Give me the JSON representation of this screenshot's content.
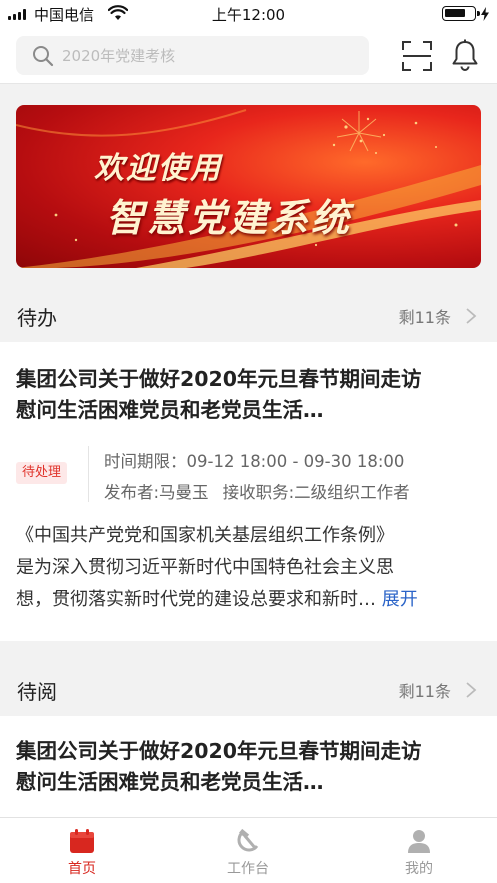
{
  "status_bar": {
    "carrier": "中国电信",
    "time": "上午12:00"
  },
  "search": {
    "placeholder": "2020年党建考核"
  },
  "icons": {
    "search": "search-icon",
    "scan": "scan-icon",
    "notifications": "bell-icon",
    "chevron": "chevron-right-icon"
  },
  "banner": {
    "line1": "欢迎使用",
    "line2": "智慧党建系统"
  },
  "todo": {
    "title": "待办",
    "remaining": "剩11条",
    "card": {
      "title_line1": "集团公司关于做好2020年元旦春节期间走访",
      "title_line2": "慰问生活困难党员和老党员生活…",
      "status": "待处理",
      "deadline": "时间期限：09-12 18:00 - 09-30 18:00",
      "publisher": "发布者:马曼玉",
      "position": "接收职务:二级组织工作者",
      "desc_line1": "《中国共产党党和国家机关基层组织工作条例》",
      "desc_line2": "是为深入贯彻习近平新时代中国特色社会主义思",
      "desc_line3": "想，贯彻落实新时代党的建设总要求和新时…",
      "expand": "展开"
    }
  },
  "toread": {
    "title": "待阅",
    "remaining": "剩11条",
    "card": {
      "title_line1": "集团公司关于做好2020年元旦春节期间走访",
      "title_line2": "慰问生活困难党员和老党员生活…"
    }
  },
  "tabbar": {
    "home": "首页",
    "workbench": "工作台",
    "mine": "我的"
  },
  "colors": {
    "accent": "#d8271f",
    "link": "#2b64c8"
  }
}
